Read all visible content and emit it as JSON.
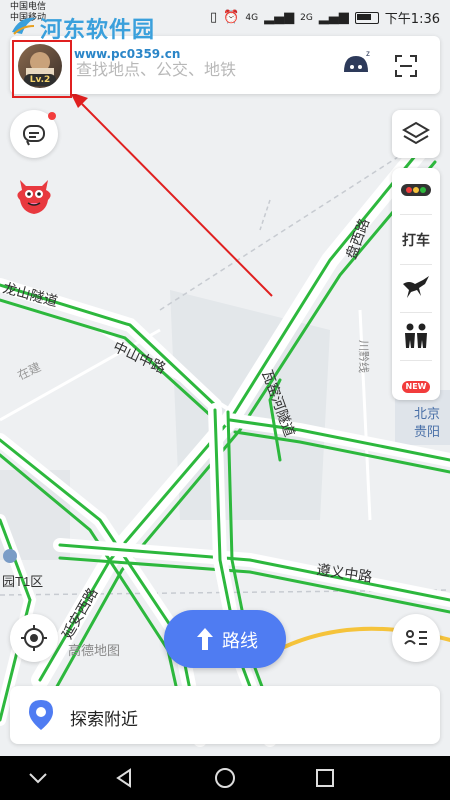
{
  "status_bar": {
    "carrier_1": "中国电信",
    "carrier_2": "中国移动",
    "network_1": "4G",
    "network_2": "2G",
    "time": "下午1:36"
  },
  "watermark": {
    "title": "河东软件园",
    "url": "www.pc0359.cn"
  },
  "search": {
    "placeholder": "查找地点、公交、地铁",
    "avatar_level": "Lv.2"
  },
  "right_panel": {
    "taxi_label": "打车",
    "new_badge": "NEW"
  },
  "map_labels": {
    "road_1": "龙山隧道",
    "road_2": "中山中路",
    "road_3": "遵义中路",
    "road_4": "延安西路",
    "road_5": "川黔线",
    "road_6": "在建",
    "road_7": "盘西路",
    "road_8": "瓦窑河隧道",
    "place_1": "北京",
    "place_2": "贵阳",
    "place_3": "园T1区"
  },
  "map_colors": {
    "smooth_traffic": "#2db83d",
    "accent": "#4f7cf2",
    "background": "#eef0f2"
  },
  "bottom": {
    "brand": "高德地图",
    "route_label": "路线",
    "explore_label": "探索附近"
  },
  "icons": {
    "layers": "layers-icon",
    "traffic": "traffic-light-icon",
    "horse": "horse-icon",
    "people": "people-icon",
    "locate": "locate-icon",
    "list": "list-icon",
    "message": "message-icon",
    "robot": "robot-icon",
    "scan": "scan-icon"
  }
}
